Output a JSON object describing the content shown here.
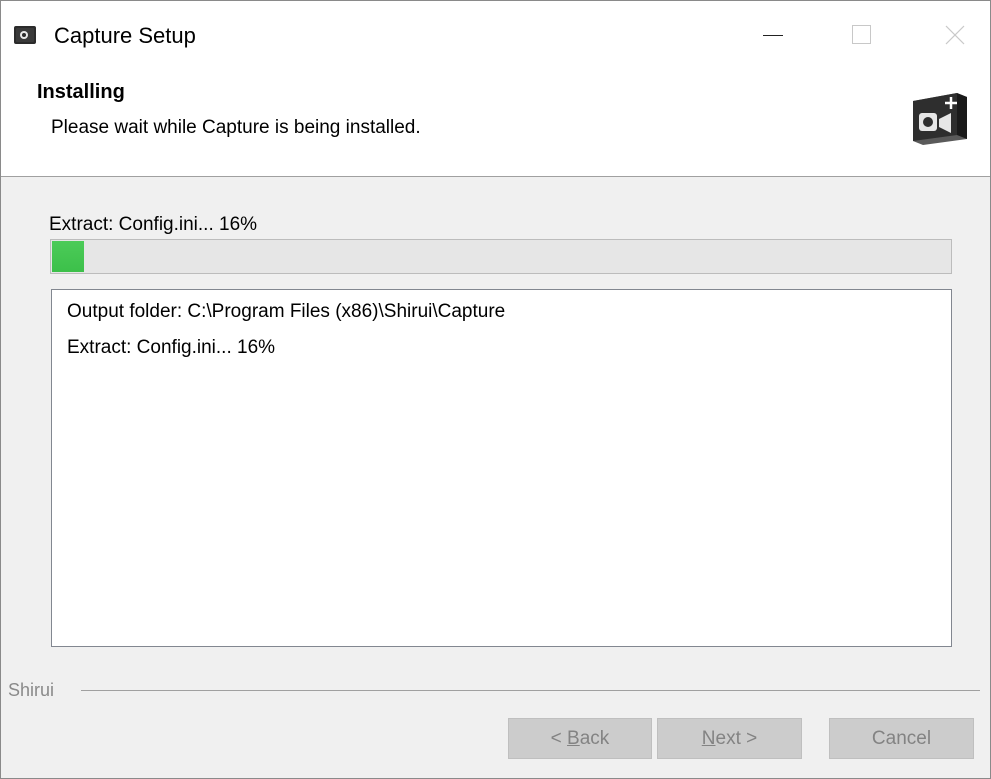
{
  "window": {
    "title": "Capture Setup",
    "controls": {
      "minimize": "minimize-icon",
      "maximize": "maximize-icon",
      "close": "close-icon"
    }
  },
  "header": {
    "title": "Installing",
    "subtitle": "Please wait while Capture is being installed.",
    "logo_icon": "capture-camera-icon"
  },
  "progress": {
    "status_text": "Extract: Config.ini... 16%",
    "percent": 16,
    "fill_color": "#4ccb58"
  },
  "log": {
    "lines": [
      "Output folder: C:\\Program Files (x86)\\Shirui\\Capture",
      "Extract: Config.ini... 16%"
    ]
  },
  "branding": {
    "text": "Shirui"
  },
  "buttons": {
    "back": {
      "prefix": "< ",
      "accel": "B",
      "rest": "ack"
    },
    "next": {
      "prefix": "",
      "accel": "N",
      "rest": "ext >"
    },
    "cancel": {
      "label": "Cancel"
    }
  }
}
